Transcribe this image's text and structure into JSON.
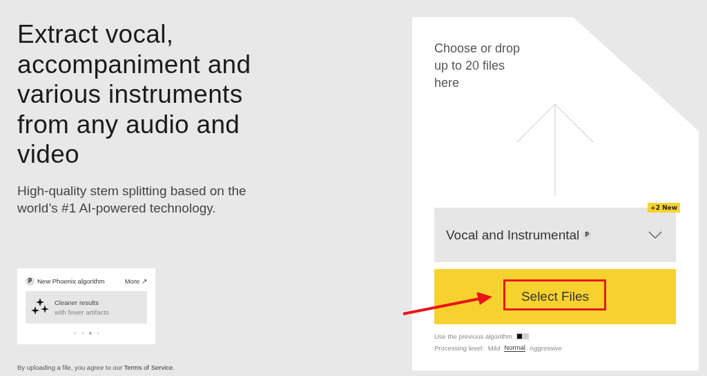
{
  "hero": {
    "title": "Extract vocal, accompaniment and various instruments from any audio and video",
    "subtitle": "High-quality stem splitting based on the world’s #1 AI-powered technology."
  },
  "promo_card": {
    "badge": "P",
    "title": "New Phoenix algorithm",
    "link": "More ↗",
    "feature_title": "Cleaner results",
    "feature_subtitle": "with fewer artifacts",
    "dots": [
      {
        "selected": false
      },
      {
        "selected": false
      },
      {
        "selected": true
      },
      {
        "selected": false
      }
    ]
  },
  "terms": {
    "text": "By uploading a file, you agree to our ",
    "link": "Terms of Service",
    "end": "."
  },
  "upload": {
    "prompt": "Choose or drop up to 20 files here",
    "dropdown": {
      "value": "Vocal and Instrumental",
      "badge": "P",
      "tag": "+2 New"
    },
    "button": "Select Files",
    "toggle": {
      "label": "Use the previous algorithm",
      "on": false
    },
    "processing": {
      "label": "Processing level:",
      "options": [
        {
          "label": "Mild",
          "selected": false
        },
        {
          "label": "Normal",
          "selected": true
        },
        {
          "label": "Aggressive",
          "selected": false
        }
      ]
    }
  },
  "annotation_arrow": {
    "color": "#e8141b"
  },
  "annotation_box": {
    "color": "#e8141b"
  }
}
